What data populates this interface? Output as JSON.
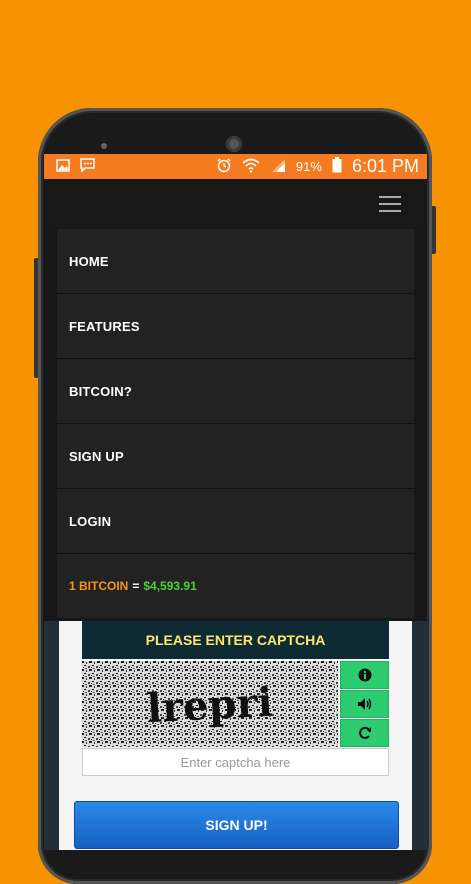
{
  "statusbar": {
    "battery_pct": "91%",
    "time": "6:01 PM",
    "left_icons": [
      "image-icon",
      "message-icon"
    ],
    "right_icons": [
      "alarm-icon",
      "wifi-icon",
      "signal-icon",
      "battery-icon"
    ]
  },
  "nav": {
    "menu_icon": "hamburger-icon",
    "items": [
      {
        "label": "HOME"
      },
      {
        "label": "FEATURES"
      },
      {
        "label": "BITCOIN?"
      },
      {
        "label": "SIGN UP"
      },
      {
        "label": "LOGIN"
      }
    ]
  },
  "price": {
    "label": "1 BITCOIN",
    "equals": "=",
    "value": "$4,593.91"
  },
  "captcha": {
    "heading": "PLEASE ENTER CAPTCHA",
    "image_text": "lrepri",
    "input_placeholder": "Enter captcha here",
    "buttons": [
      "info-icon",
      "audio-icon",
      "refresh-icon"
    ]
  },
  "form": {
    "signup_label": "SIGN UP!"
  },
  "colors": {
    "background": "#F79200",
    "statusbar": "#F47B20",
    "price_label": "#F7941D",
    "price_value": "#4CD137",
    "captcha_heading": "#FFE66D",
    "captcha_button": "#2ecc71",
    "signup_button": "#1f75d6"
  }
}
